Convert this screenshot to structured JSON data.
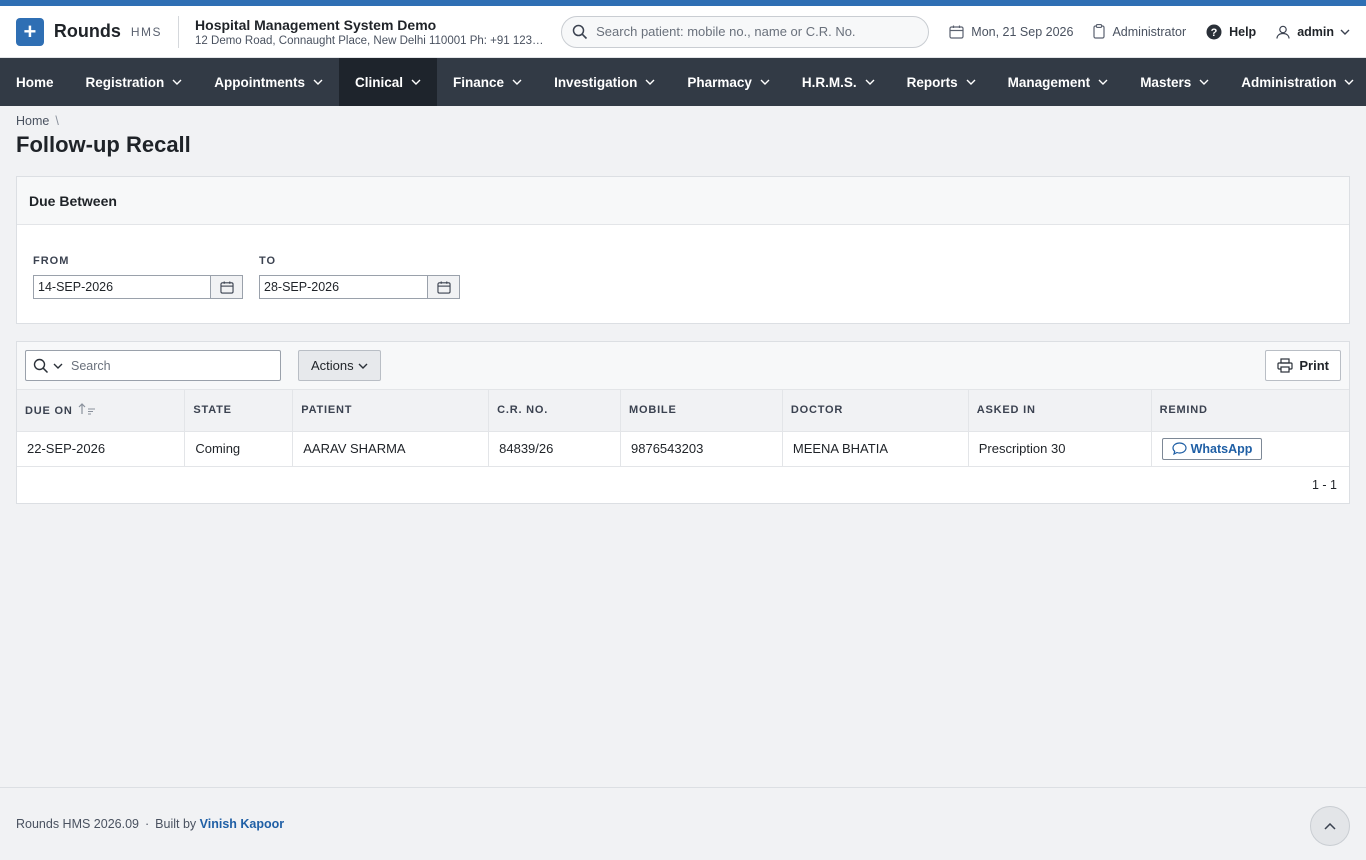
{
  "app": {
    "brand": "Rounds",
    "brand_sub": "HMS",
    "org_name": "Hospital Management System Demo",
    "org_address": "12 Demo Road, Connaught Place, New Delhi 110001 Ph: +91 123…"
  },
  "header": {
    "search_placeholder": "Search patient: mobile no., name or C.R. No.",
    "date": "Mon, 21 Sep 2026",
    "role": "Administrator",
    "help": "Help",
    "user": "admin"
  },
  "nav": [
    {
      "label": "Home",
      "dropdown": false
    },
    {
      "label": "Registration",
      "dropdown": true
    },
    {
      "label": "Appointments",
      "dropdown": true
    },
    {
      "label": "Clinical",
      "dropdown": true,
      "active": true
    },
    {
      "label": "Finance",
      "dropdown": true
    },
    {
      "label": "Investigation",
      "dropdown": true
    },
    {
      "label": "Pharmacy",
      "dropdown": true
    },
    {
      "label": "H.R.M.S.",
      "dropdown": true
    },
    {
      "label": "Reports",
      "dropdown": true
    },
    {
      "label": "Management",
      "dropdown": true
    },
    {
      "label": "Masters",
      "dropdown": true
    },
    {
      "label": "Administration",
      "dropdown": true
    }
  ],
  "breadcrumb": {
    "home": "Home",
    "sep": "\\"
  },
  "page_title": "Follow-up Recall",
  "filter": {
    "title": "Due Between",
    "from_label": "FROM",
    "from_value": "14-SEP-2026",
    "to_label": "TO",
    "to_value": "28-SEP-2026"
  },
  "report": {
    "search_placeholder": "Search",
    "actions_label": "Actions",
    "print_label": "Print",
    "columns": [
      "DUE ON",
      "STATE",
      "PATIENT",
      "C.R. NO.",
      "MOBILE",
      "DOCTOR",
      "ASKED IN",
      "REMIND"
    ],
    "rows": [
      {
        "due_on": "22-SEP-2026",
        "state": "Coming",
        "patient": "AARAV SHARMA",
        "cr_no": "84839/26",
        "mobile": "9876543203",
        "doctor": "MEENA BHATIA",
        "asked_in": "Prescription 30",
        "remind": "WhatsApp"
      }
    ],
    "pagination": "1 - 1"
  },
  "footer": {
    "version": "Rounds HMS 2026.09",
    "dot": "·",
    "built_by": "Built by",
    "author": "Vinish Kapoor"
  },
  "colors": {
    "accent": "#2f6fb4",
    "nav_bg": "#323a45",
    "nav_active": "#1e242c",
    "link": "#1f5fa5"
  }
}
